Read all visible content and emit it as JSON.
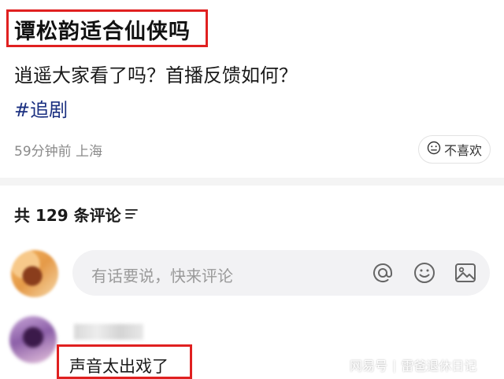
{
  "post": {
    "title": "谭松韵适合仙侠吗",
    "body": "逍遥大家看了吗？首播反馈如何？",
    "hashtag": "#追剧",
    "meta": "59分钟前 上海",
    "dislike_label": "不喜欢"
  },
  "comments": {
    "count_label": "共 129 条评论",
    "input_placeholder": "有话要说，快来评论",
    "items": [
      {
        "text": "声音太出戏了"
      }
    ]
  },
  "watermark": {
    "site": "网易号",
    "separator": "|",
    "account": "雷爸退休日记"
  },
  "colors": {
    "highlight_box": "#e02020",
    "hashtag": "#1a2f80",
    "meta": "#8a8a8a",
    "input_bg": "#f2f2f4"
  }
}
